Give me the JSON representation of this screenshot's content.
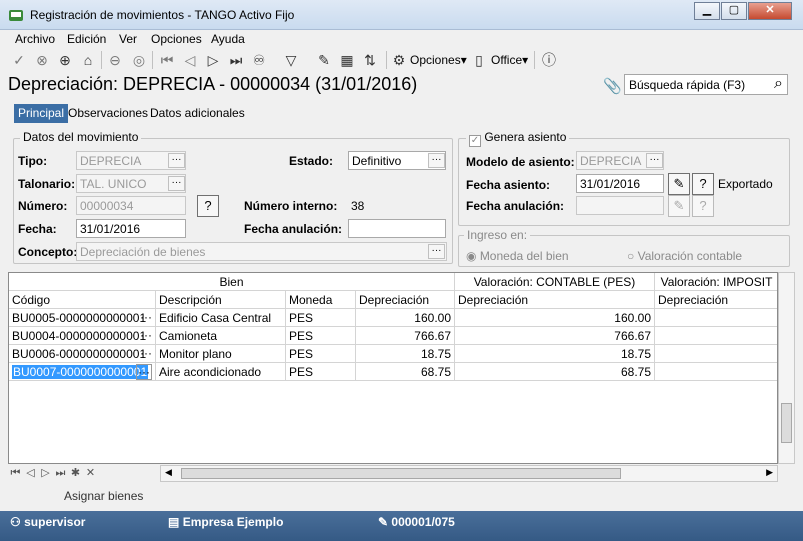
{
  "window": {
    "title": "Registración de movimientos - TANGO Activo Fijo",
    "btn_min": "▁",
    "btn_max": "▢",
    "btn_close": "✕"
  },
  "menu": [
    {
      "label": "Archivo"
    },
    {
      "label": "Edición"
    },
    {
      "label": "Ver"
    },
    {
      "label": "Opciones"
    },
    {
      "label": "Ayuda"
    }
  ],
  "toolbar": {
    "opciones_label": "Opciones",
    "office_label": "Office",
    "dropdown_arrow": "▾",
    "icons": [
      "check-icon",
      "cancel-icon",
      "add-icon",
      "home-icon",
      "remove-icon",
      "first-icon",
      "prev-icon",
      "next-icon",
      "last-icon",
      "binoculars-icon",
      "filter-icon",
      "edit-icon",
      "grid-icon",
      "sort-icon",
      "gear-icon",
      "office-icon",
      "help-icon"
    ]
  },
  "header": {
    "title": "Depreciación: DEPRECIA - 00000034 (31/01/2016)",
    "search_placeholder": "Búsqueda rápida (F3)"
  },
  "tabs": [
    {
      "label": "Principal",
      "active": true
    },
    {
      "label": "Observaciones",
      "active": false
    },
    {
      "label": "Datos adicionales",
      "active": false
    }
  ],
  "movimiento": {
    "group_title": "Datos del movimiento",
    "tipo_label": "Tipo:",
    "tipo_value": "DEPRECIA",
    "talonario_label": "Talonario:",
    "talonario_value": "TAL. UNICO",
    "numero_label": "Número:",
    "numero_value": "00000034",
    "fecha_label": "Fecha:",
    "fecha_value": "31/01/2016",
    "concepto_label": "Concepto:",
    "concepto_value": "Depreciación de bienes",
    "estado_label": "Estado:",
    "estado_value": "Definitivo",
    "numint_label": "Número interno:",
    "numint_value": "38",
    "fechaanul_label": "Fecha anulación:",
    "fechaanul_value": ""
  },
  "asiento": {
    "group_title": "Genera asiento",
    "checked": true,
    "modelo_label": "Modelo de asiento:",
    "modelo_value": "DEPRECIA",
    "fecha_label": "Fecha asiento:",
    "fecha_value": "31/01/2016",
    "status": "Exportado",
    "fechaanul_label": "Fecha anulación:",
    "fechaanul_value": ""
  },
  "ingreso": {
    "group_title": "Ingreso en:",
    "opt1": "Moneda del bien",
    "opt2": "Valoración contable",
    "selected": 1
  },
  "grid": {
    "group_bien": "Bien",
    "group_contable": "Valoración: CONTABLE  (PES)",
    "group_imposit": "Valoración: IMPOSIT",
    "columns": [
      "Código",
      "Descripción",
      "Moneda",
      "Depreciación",
      "Depreciación",
      "Depreciación"
    ],
    "rows": [
      {
        "codigo": "BU0005-0000000000001",
        "descripcion": "Edificio Casa Central",
        "moneda": "PES",
        "dep": "160.00",
        "dep_cont": "160.00",
        "dep_imp": ""
      },
      {
        "codigo": "BU0004-0000000000001",
        "descripcion": "Camioneta",
        "moneda": "PES",
        "dep": "766.67",
        "dep_cont": "766.67",
        "dep_imp": ""
      },
      {
        "codigo": "BU0006-0000000000001",
        "descripcion": "Monitor plano",
        "moneda": "PES",
        "dep": "18.75",
        "dep_cont": "18.75",
        "dep_imp": ""
      },
      {
        "codigo": "BU0007-0000000000001",
        "descripcion": "Aire acondicionado",
        "moneda": "PES",
        "dep": "68.75",
        "dep_cont": "68.75",
        "dep_imp": ""
      }
    ]
  },
  "footer": {
    "assign_label": "Asignar bienes",
    "user": "supervisor",
    "company": "Empresa Ejemplo",
    "record": "000001/075"
  }
}
